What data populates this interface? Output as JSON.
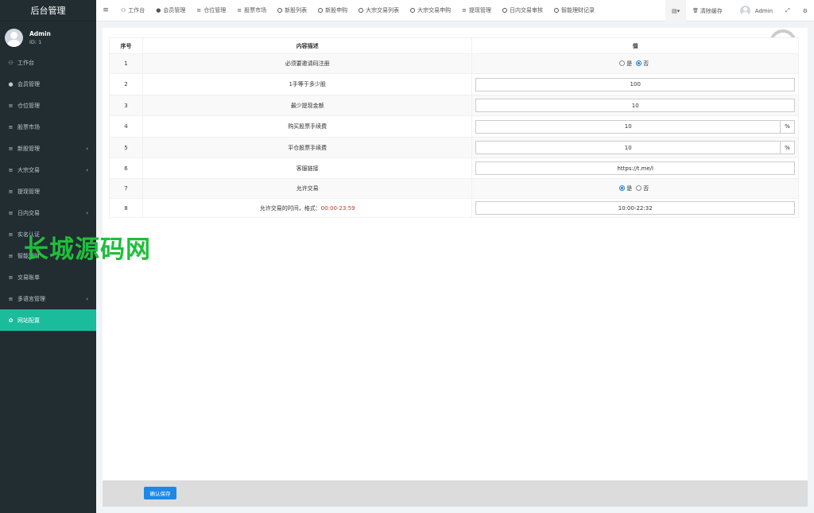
{
  "sidebar": {
    "logo": "后台管理",
    "user": {
      "name": "Admin",
      "id": "ID: 1"
    },
    "items": [
      {
        "label": "工作台",
        "icon": "dashboard-icon",
        "glyph": "⚇",
        "caret": ""
      },
      {
        "label": "会员管理",
        "icon": "user-circle-icon",
        "glyph": "●",
        "caret": ""
      },
      {
        "label": "仓位管理",
        "icon": "list-icon",
        "glyph": "≡",
        "caret": ""
      },
      {
        "label": "股票市场",
        "icon": "list-icon",
        "glyph": "≡",
        "caret": ""
      },
      {
        "label": "新股管理",
        "icon": "list-icon",
        "glyph": "≡",
        "caret": "‹"
      },
      {
        "label": "大宗交易",
        "icon": "list-icon",
        "glyph": "≡",
        "caret": "‹"
      },
      {
        "label": "提现管理",
        "icon": "list-icon",
        "glyph": "≡",
        "caret": ""
      },
      {
        "label": "日内交易",
        "icon": "list-icon",
        "glyph": "≡",
        "caret": "‹"
      },
      {
        "label": "实名认证",
        "icon": "list-icon",
        "glyph": "≡",
        "caret": ""
      },
      {
        "label": "智能理财",
        "icon": "list-icon",
        "glyph": "≡",
        "caret": ""
      },
      {
        "label": "交易账单",
        "icon": "list-icon",
        "glyph": "≡",
        "caret": ""
      },
      {
        "label": "多语言管理",
        "icon": "list-icon",
        "glyph": "≡",
        "caret": "‹"
      },
      {
        "label": "网站配置",
        "icon": "gear-icon",
        "glyph": "✿",
        "caret": "",
        "active": true
      }
    ]
  },
  "topbar": {
    "toggle": "≡",
    "tabs": [
      {
        "label": "工作台",
        "icon": "dashboard-icon",
        "glyph": "⚇",
        "ring": false
      },
      {
        "label": "会员管理",
        "icon": "user-circle-icon",
        "glyph": "●",
        "ring": false
      },
      {
        "label": "仓位管理",
        "icon": "list-icon",
        "glyph": "≡",
        "ring": false
      },
      {
        "label": "股票市场",
        "icon": "list-icon",
        "glyph": "≡",
        "ring": false
      },
      {
        "label": "新股列表",
        "icon": "circle-icon",
        "glyph": "",
        "ring": true
      },
      {
        "label": "新股申购",
        "icon": "circle-icon",
        "glyph": "",
        "ring": true
      },
      {
        "label": "大宗交易列表",
        "icon": "circle-icon",
        "glyph": "",
        "ring": true
      },
      {
        "label": "大宗交易申购",
        "icon": "circle-icon",
        "glyph": "",
        "ring": true
      },
      {
        "label": "提现管理",
        "icon": "list-icon",
        "glyph": "≡",
        "ring": false
      },
      {
        "label": "日内交易审核",
        "icon": "circle-icon",
        "glyph": "",
        "ring": true
      },
      {
        "label": "智能理财记录",
        "icon": "circle-icon",
        "glyph": "",
        "ring": true
      }
    ],
    "right": {
      "layout_glyph": "▤▾",
      "clear_cache": "清除缓存",
      "clear_glyph": "🗑",
      "user": "Admin",
      "fullscreen_glyph": "⤢",
      "settings_glyph": "⚙"
    }
  },
  "table": {
    "headers": [
      "序号",
      "内容描述",
      "值"
    ],
    "rows": [
      {
        "no": "1",
        "desc": "必须要邀请码注册",
        "type": "radio",
        "options": [
          "是",
          "否"
        ],
        "selected": 1
      },
      {
        "no": "2",
        "desc": "1手等于多少股",
        "type": "input",
        "value": "100"
      },
      {
        "no": "3",
        "desc": "最少提现金额",
        "type": "input",
        "value": "10"
      },
      {
        "no": "4",
        "desc": "购买股票手续费",
        "type": "input-addon",
        "value": "10",
        "addon": "%"
      },
      {
        "no": "5",
        "desc": "平仓股票手续费",
        "type": "input-addon",
        "value": "10",
        "addon": "%"
      },
      {
        "no": "6",
        "desc": "客服链接",
        "type": "input",
        "value": "https://t.me/l"
      },
      {
        "no": "7",
        "desc": "允许交易",
        "type": "radio",
        "options": [
          "是",
          "否"
        ],
        "selected": 0
      },
      {
        "no": "8",
        "desc": "允许交易的时间，格式：",
        "desc_extra": "00:00-23:59",
        "type": "input",
        "value": "10:00-22:32"
      }
    ]
  },
  "footer": {
    "save_label": "确认保存"
  },
  "watermark": "长城源码网",
  "colors": {
    "sidebar_bg": "#222d32",
    "active": "#1abc9c",
    "primary": "#1e88e5",
    "watermark": "#1fbf3a"
  }
}
